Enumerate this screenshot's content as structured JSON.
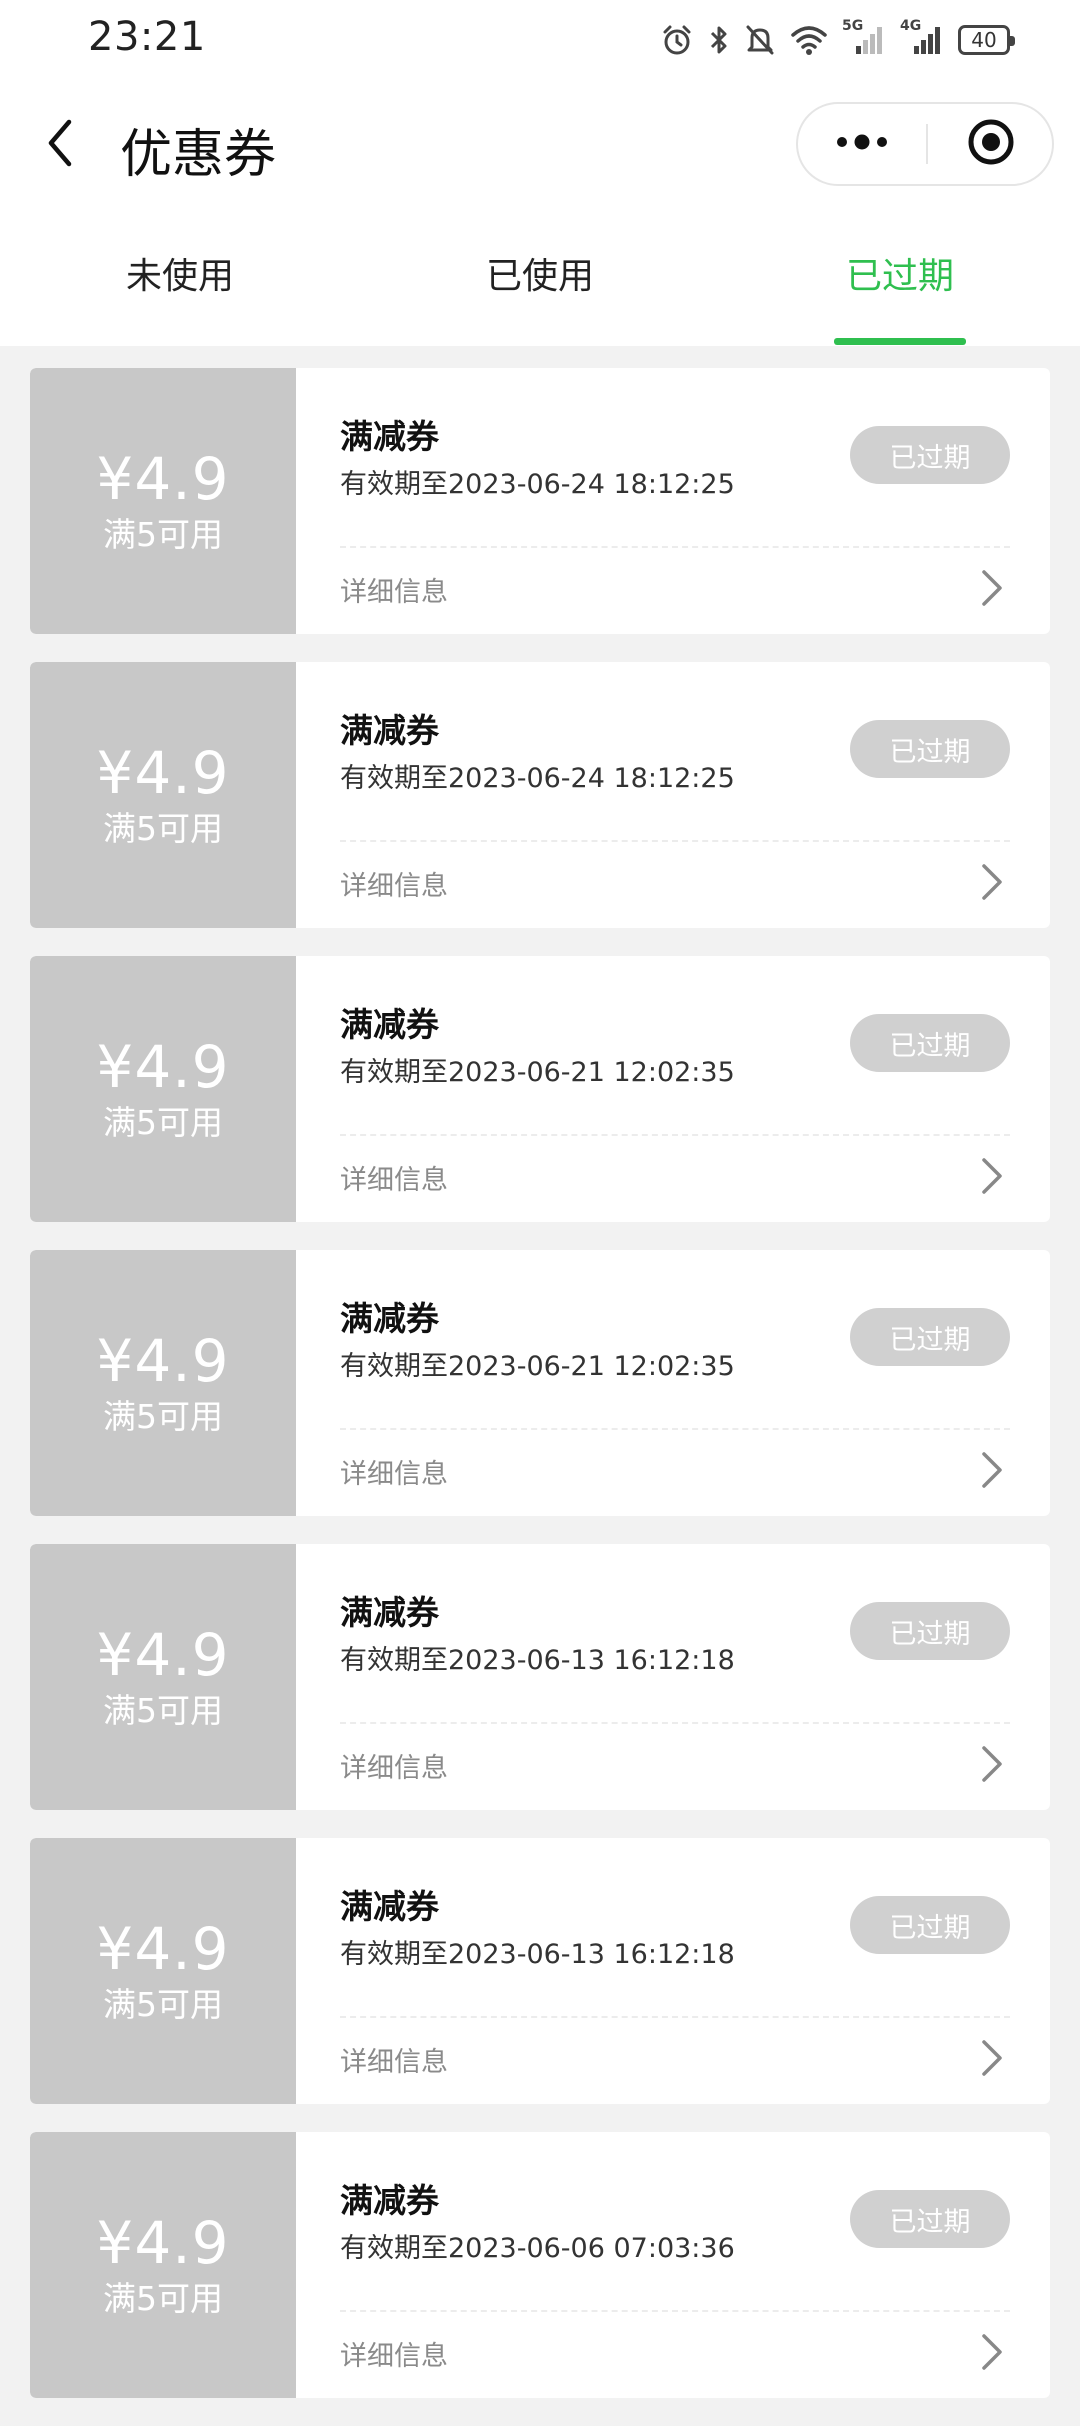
{
  "status_bar": {
    "time": "23:21",
    "battery": "40",
    "network_1": "5G",
    "network_2": "4G",
    "icons": [
      "alarm-icon",
      "bluetooth-icon",
      "mute-icon",
      "wifi-icon",
      "signal-5g-icon",
      "signal-4g-icon",
      "battery-icon"
    ]
  },
  "header": {
    "title": "优惠券",
    "back_icon": "chevron-left-icon",
    "more_icon": "more-dots-icon",
    "close_icon": "target-close-icon"
  },
  "tabs": [
    {
      "label": "未使用",
      "active": false
    },
    {
      "label": "已使用",
      "active": false
    },
    {
      "label": "已过期",
      "active": true
    }
  ],
  "colors": {
    "accent": "#2fbf4f",
    "coupon_left_bg": "#c8c8c8",
    "status_pill_bg": "#d0d0d0",
    "page_bg": "#f2f2f2"
  },
  "coupons": [
    {
      "amount": "¥4.9",
      "condition": "满5可用",
      "name": "满减券",
      "expiry": "有效期至2023-06-24 18:12:25",
      "status": "已过期",
      "detail": "详细信息"
    },
    {
      "amount": "¥4.9",
      "condition": "满5可用",
      "name": "满减券",
      "expiry": "有效期至2023-06-24 18:12:25",
      "status": "已过期",
      "detail": "详细信息"
    },
    {
      "amount": "¥4.9",
      "condition": "满5可用",
      "name": "满减券",
      "expiry": "有效期至2023-06-21 12:02:35",
      "status": "已过期",
      "detail": "详细信息"
    },
    {
      "amount": "¥4.9",
      "condition": "满5可用",
      "name": "满减券",
      "expiry": "有效期至2023-06-21 12:02:35",
      "status": "已过期",
      "detail": "详细信息"
    },
    {
      "amount": "¥4.9",
      "condition": "满5可用",
      "name": "满减券",
      "expiry": "有效期至2023-06-13 16:12:18",
      "status": "已过期",
      "detail": "详细信息"
    },
    {
      "amount": "¥4.9",
      "condition": "满5可用",
      "name": "满减券",
      "expiry": "有效期至2023-06-13 16:12:18",
      "status": "已过期",
      "detail": "详细信息"
    },
    {
      "amount": "¥4.9",
      "condition": "满5可用",
      "name": "满减券",
      "expiry": "有效期至2023-06-06 07:03:36",
      "status": "已过期",
      "detail": "详细信息"
    }
  ]
}
